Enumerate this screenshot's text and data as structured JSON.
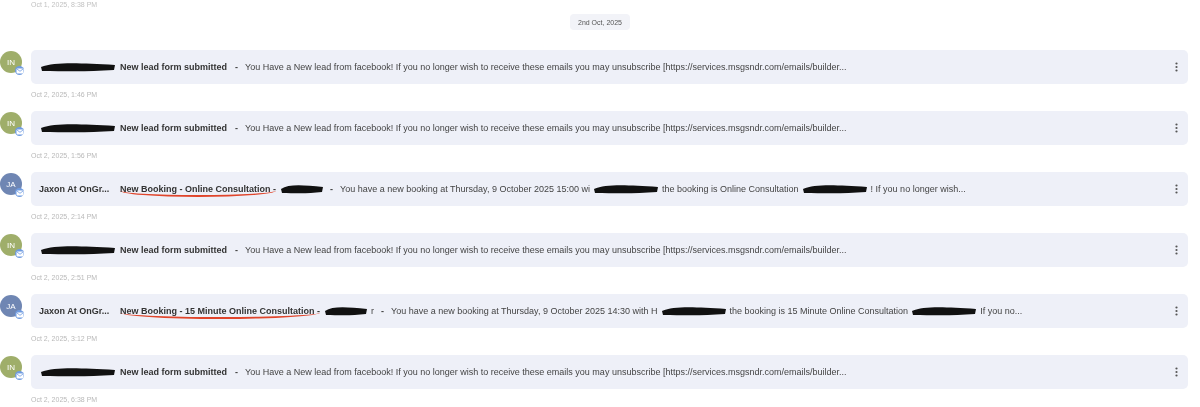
{
  "previous_time": "Oct 1, 2025, 8:38 PM",
  "date_separator": "2nd Oct, 2025",
  "messages": [
    {
      "initials": "IN",
      "color": "#9fae6a",
      "sender": [
        {
          "kind": "redacted"
        }
      ],
      "subject": "New lead form submitted",
      "underlined": false,
      "separator": "-",
      "preview": [
        {
          "kind": "text",
          "text": "You Have a New lead from facebook! If you no longer wish to receive these emails you may unsubscribe [https://services.msgsndr.com/emails/builder..."
        }
      ],
      "time": "Oct 2, 2025, 1:46 PM"
    },
    {
      "initials": "IN",
      "color": "#9fae6a",
      "sender": [
        {
          "kind": "redacted"
        }
      ],
      "subject": "New lead form submitted",
      "underlined": false,
      "separator": "-",
      "preview": [
        {
          "kind": "text",
          "text": "You Have a New lead from facebook! If you no longer wish to receive these emails you may unsubscribe [https://services.msgsndr.com/emails/builder..."
        }
      ],
      "time": "Oct 2, 2025, 1:56 PM"
    },
    {
      "initials": "JA",
      "color": "#6f86b3",
      "sender": [
        {
          "kind": "text",
          "text": "Jaxon At OnGr..."
        }
      ],
      "subject": "New Booking - Online Consultation -",
      "underlined": true,
      "subject_tail": [
        {
          "kind": "redacted"
        }
      ],
      "separator": "-",
      "preview": [
        {
          "kind": "text",
          "text": "You have a new booking at Thursday, 9 October 2025 15:00 wi"
        },
        {
          "kind": "redacted"
        },
        {
          "kind": "text",
          "text": "the booking is Online Consultation"
        },
        {
          "kind": "redacted"
        },
        {
          "kind": "text",
          "text": "! If you no longer wish..."
        }
      ],
      "time": "Oct 2, 2025, 2:14 PM"
    },
    {
      "initials": "IN",
      "color": "#9fae6a",
      "sender": [
        {
          "kind": "redacted"
        }
      ],
      "subject": "New lead form submitted",
      "underlined": false,
      "separator": "-",
      "preview": [
        {
          "kind": "text",
          "text": "You Have a New lead from facebook! If you no longer wish to receive these emails you may unsubscribe [https://services.msgsndr.com/emails/builder..."
        }
      ],
      "time": "Oct 2, 2025, 2:51 PM"
    },
    {
      "initials": "JA",
      "color": "#6f86b3",
      "sender": [
        {
          "kind": "text",
          "text": "Jaxon At OnGr..."
        }
      ],
      "subject": "New Booking - 15 Minute Online Consultation -",
      "underlined": true,
      "subject_tail": [
        {
          "kind": "redacted"
        },
        {
          "kind": "text",
          "text": "r"
        }
      ],
      "separator": "-",
      "preview": [
        {
          "kind": "text",
          "text": "You have a new booking at Thursday, 9 October 2025 14:30 with H"
        },
        {
          "kind": "redacted"
        },
        {
          "kind": "text",
          "text": "the booking is 15 Minute Online Consultation"
        },
        {
          "kind": "redacted"
        },
        {
          "kind": "text",
          "text": "If you no..."
        }
      ],
      "time": "Oct 2, 2025, 3:12 PM"
    },
    {
      "initials": "IN",
      "color": "#9fae6a",
      "sender": [
        {
          "kind": "redacted"
        }
      ],
      "subject": "New lead form submitted",
      "underlined": false,
      "separator": "-",
      "preview": [
        {
          "kind": "text",
          "text": "You Have a New lead from facebook! If you no longer wish to receive these emails you may unsubscribe [https://services.msgsndr.com/emails/builder..."
        }
      ],
      "time": "Oct 2, 2025, 6:38 PM"
    }
  ]
}
